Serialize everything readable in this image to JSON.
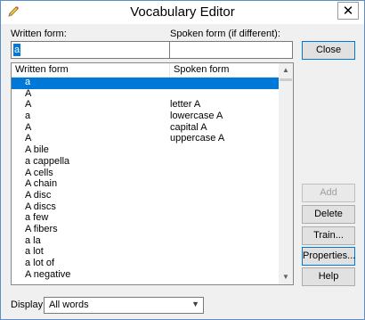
{
  "window": {
    "title": "Vocabulary Editor",
    "close_glyph": "✕"
  },
  "fields": {
    "written_label": "Written form:",
    "written_value": "a",
    "spoken_label": "Spoken form (if different):",
    "spoken_value": ""
  },
  "list": {
    "columns": [
      "Written form",
      "Spoken form"
    ],
    "selected_index": 0,
    "rows": [
      {
        "written": "a",
        "spoken": ""
      },
      {
        "written": "A",
        "spoken": ""
      },
      {
        "written": "A",
        "spoken": "letter A"
      },
      {
        "written": "a",
        "spoken": "lowercase A"
      },
      {
        "written": "A",
        "spoken": "capital A"
      },
      {
        "written": "A",
        "spoken": "uppercase A"
      },
      {
        "written": "A bile",
        "spoken": ""
      },
      {
        "written": "a cappella",
        "spoken": ""
      },
      {
        "written": "A cells",
        "spoken": ""
      },
      {
        "written": "A chain",
        "spoken": ""
      },
      {
        "written": "A disc",
        "spoken": ""
      },
      {
        "written": "A discs",
        "spoken": ""
      },
      {
        "written": "a few",
        "spoken": ""
      },
      {
        "written": "A fibers",
        "spoken": ""
      },
      {
        "written": "a la",
        "spoken": ""
      },
      {
        "written": "a lot",
        "spoken": ""
      },
      {
        "written": "a lot of",
        "spoken": ""
      },
      {
        "written": "A negative",
        "spoken": ""
      }
    ]
  },
  "buttons": {
    "close": "Close",
    "add": "Add",
    "delete": "Delete",
    "train": "Train...",
    "properties": "Properties...",
    "help": "Help"
  },
  "display": {
    "label": "Display:",
    "value": "All words"
  },
  "colors": {
    "selection": "#0078d7",
    "desktop": "#1a7ad8"
  }
}
